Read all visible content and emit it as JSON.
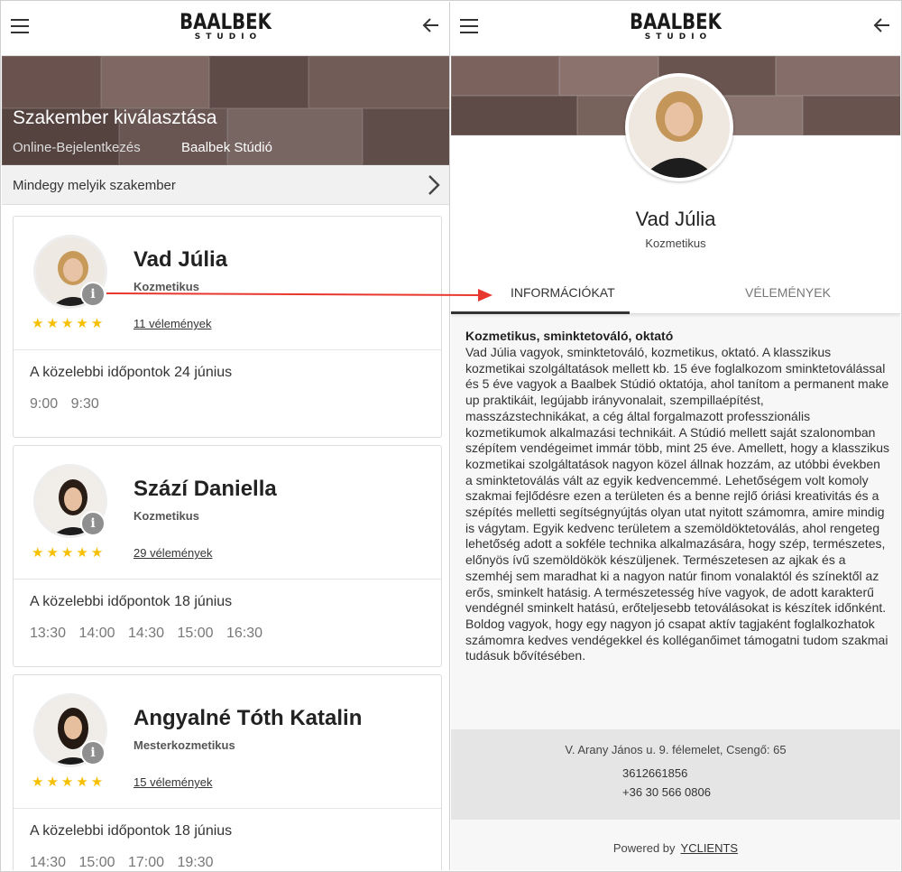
{
  "header": {
    "logo_main": "BAALBEK",
    "logo_sub": "STUDIO"
  },
  "left": {
    "hero": {
      "title": "Szakember kiválasztása",
      "breadcrumb_1": "Online-Bejelentkezés",
      "breadcrumb_2": "Baalbek Stúdió"
    },
    "any_specialist": "Mindegy melyik szakember",
    "specialists": [
      {
        "name": "Vad Júlia",
        "role": "Kozmetikus",
        "stars": "★★★★★",
        "rating": 5,
        "reviews": "11 vélemények",
        "next": "A közelebbi időpontok 24 június",
        "slots": [
          "9:00",
          "9:30"
        ]
      },
      {
        "name": "Szází Daniella",
        "role": "Kozmetikus",
        "stars": "★★★★★",
        "rating": 5,
        "reviews": "29 vélemények",
        "next": "A közelebbi időpontok 18 június",
        "slots": [
          "13:30",
          "14:00",
          "14:30",
          "15:00",
          "16:30"
        ]
      },
      {
        "name": "Angyalné Tóth Katalin",
        "role": "Mesterkozmetikus",
        "stars": "★★★★★",
        "rating": 5,
        "reviews": "15 vélemények",
        "next": "A közelebbi időpontok 18 június",
        "slots": [
          "14:30",
          "15:00",
          "17:00",
          "19:30"
        ]
      }
    ]
  },
  "right": {
    "name": "Vad Júlia",
    "role": "Kozmetikus",
    "tabs": [
      "INFORMÁCIÓKAT",
      "VÉLEMÉNYEK"
    ],
    "bio_title": "Kozmetikus, sminktetováló, oktató",
    "bio": "Vad Júlia vagyok, sminktetováló, kozmetikus, oktató. A klasszikus kozmetikai szolgáltatások mellett kb. 15 éve foglalkozom sminktetoválással és 5 éve vagyok a Baalbek Stúdió oktatója, ahol tanítom a permanent make up praktikáit, legújabb irányvonalait, szempillaépítést, masszázstechnikákat, a cég által forgalmazott professzionális kozmetikumok alkalmazási technikáit. A Stúdió mellett saját szalonomban szépítem vendégeimet immár több, mint 25 éve. Amellett, hogy a klasszikus kozmetikai szolgáltatások nagyon közel állnak hozzám, az utóbbi években a sminktetoválás vált az egyik kedvencemmé. Lehetőségem volt komoly szakmai fejlődésre ezen a területen és a benne rejlő óriási kreativitás és a szépítés melletti segítségnyújtás olyan utat nyitott számomra, amire mindig is vágytam. Egyik kedvenc területem a szemöldöktetoválás, ahol rengeteg lehetőség adott a sokféle technika alkalmazására, hogy szép, természetes, előnyös ívű szemöldökök készüljenek. Természetesen az ajkak és a szemhéj sem maradhat ki a nagyon natúr finom vonalaktól és színektől az erős, sminkelt hatásig. A természetesség híve vagyok, de adott karakterű vendégnél sminkelt hatású, erőteljesebb tetoválásokat is készítek időnként. Boldog vagyok, hogy egy nagyon jó csapat aktív tagjaként foglalkozhatok számomra kedves vendégekkel és kolléganőimet támogatni tudom szakmai tudásuk bővítésében.",
    "address": "V. Arany János u. 9. félemelet, Csengő: 65",
    "phone_1": "3612661856",
    "phone_2": "+36 30 566 0806",
    "powered_by": "Powered by",
    "powered_link": "YCLIENTS"
  },
  "colors": {
    "star": "#f6c000",
    "arrow": "#e8372f",
    "info_badge": "#8f8f8f"
  },
  "icons": [
    "menu-icon",
    "back-arrow-icon",
    "chevron-right-icon",
    "info-icon",
    "star-icon"
  ]
}
